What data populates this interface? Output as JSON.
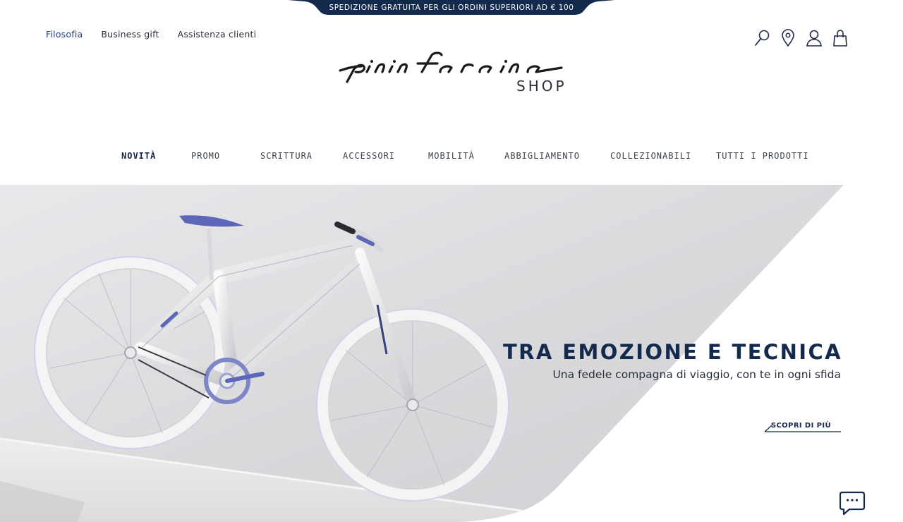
{
  "promo_bar": {
    "text": "SPEDIZIONE GRATUITA PER GLI ORDINI SUPERIORI AD € 100",
    "color": "#132a4c"
  },
  "utility_nav": [
    {
      "label": "Filosofia",
      "active": true
    },
    {
      "label": "Business gift",
      "active": false
    },
    {
      "label": "Assistenza clienti",
      "active": false
    }
  ],
  "header_icons": [
    "search-icon",
    "store-locator-icon",
    "account-icon",
    "cart-icon"
  ],
  "logo": {
    "wordmark": "pininfarina",
    "sub": "SHOP"
  },
  "main_nav": [
    {
      "label": "NOVITÀ",
      "active": true
    },
    {
      "label": "PROMO",
      "active": false
    },
    {
      "label": "SCRITTURA",
      "active": false
    },
    {
      "label": "ACCESSORI",
      "active": false
    },
    {
      "label": "MOBILITÀ",
      "active": false
    },
    {
      "label": "ABBIGLIAMENTO",
      "active": false
    },
    {
      "label": "COLLEZIONABILI",
      "active": false
    },
    {
      "label": "TUTTI I PRODOTTI",
      "active": false
    }
  ],
  "hero": {
    "title": "TRA EMOZIONE E TECNICA",
    "subtitle": "Una fedele compagna di viaggio, con te in ogni sfida",
    "cta": "SCOPRI DI PIÙ",
    "accent": "#132a4c",
    "bike_accent": "#5c67b8"
  },
  "chat": {
    "icon": "chat-bubble-icon"
  }
}
